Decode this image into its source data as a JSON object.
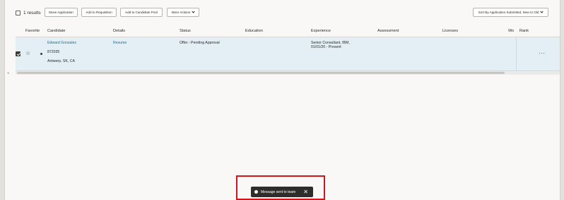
{
  "toolbar": {
    "results_label": "1 results",
    "buttons": [
      "Move Application",
      "Add to Requisition",
      "Add to Candidate Pool"
    ],
    "more_actions": "More Actions",
    "sort_label": "Sort By Application Submitted, New to Old"
  },
  "table": {
    "headers": {
      "favorite": "Favorite",
      "candidate": "Candidate",
      "details": "Details",
      "status": "Status",
      "education": "Education",
      "experience": "Experience",
      "assessment": "Assessment",
      "licenses": "Licenses",
      "work": "Wo",
      "rank": "Rank"
    },
    "rows": [
      {
        "candidate_name": "Edward Gonzalez",
        "candidate_id": "872035",
        "location": "Antwerp, SK, CA",
        "details_link": "Resume",
        "status": "Offer - Pending Approval",
        "experience_line1": "Senior Consultant, IBM,",
        "experience_line2": "01/01/20 - Present",
        "more_icon": "more-horizontal-icon"
      }
    ]
  },
  "toast": {
    "message": "Message sent to team"
  },
  "colors": {
    "row_selected": "#e3eef5",
    "link": "#1f6f8b",
    "toast_bg": "#2f2d2b",
    "highlight": "#d4141c"
  }
}
